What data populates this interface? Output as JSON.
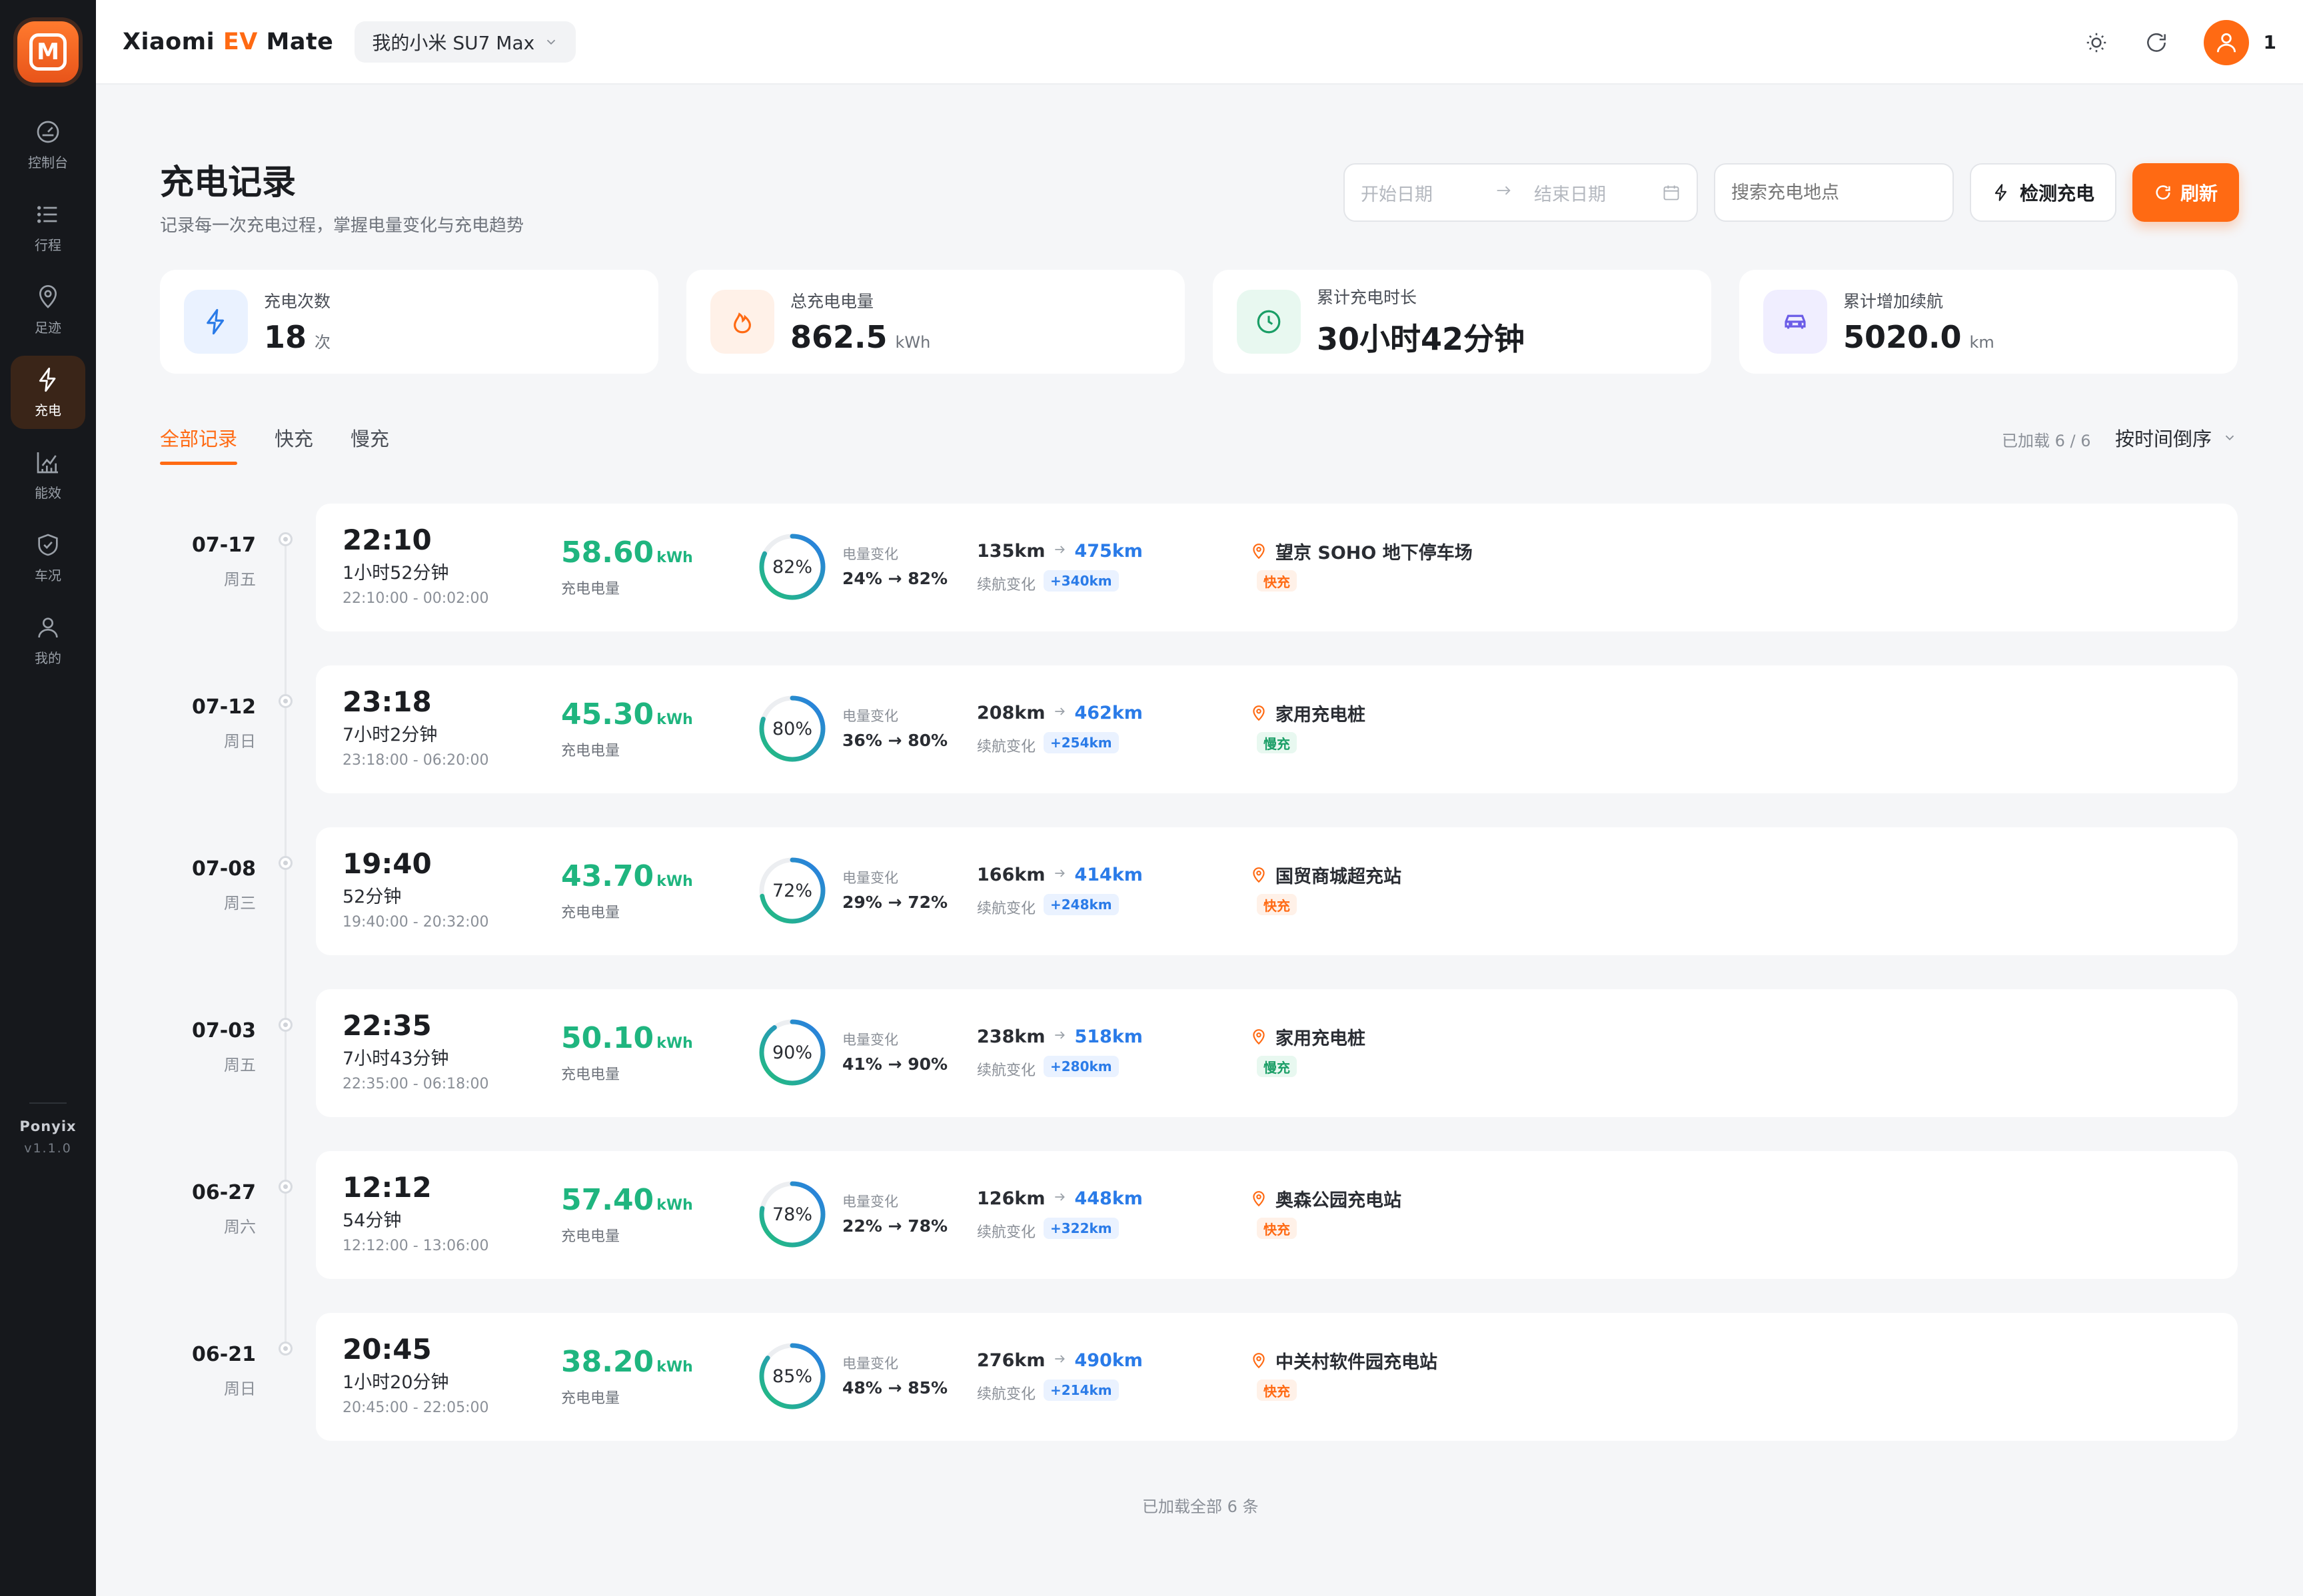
{
  "app": {
    "logo_letter": "M",
    "brand_prefix": "Xiaomi ",
    "brand_ev": "EV",
    "brand_suffix": " Mate",
    "car": "我的小米 SU7 Max",
    "user_count": "1",
    "accent_color": "#ff6a13"
  },
  "sidebar": {
    "items": [
      {
        "label": "控制台",
        "icon": "gauge-icon"
      },
      {
        "label": "行程",
        "icon": "list-icon"
      },
      {
        "label": "足迹",
        "icon": "map-pin-icon"
      },
      {
        "label": "充电",
        "icon": "lightning-icon"
      },
      {
        "label": "能效",
        "icon": "chart-icon"
      },
      {
        "label": "车况",
        "icon": "shield-check-icon"
      },
      {
        "label": "我的",
        "icon": "user-icon"
      }
    ],
    "active": "充电",
    "footer_name": "Ponyix",
    "footer_version": "v1.1.0"
  },
  "page": {
    "title": "充电记录",
    "subtitle": "记录每一次充电过程，掌握电量变化与充电趋势",
    "start_date_placeholder": "开始日期",
    "end_date_placeholder": "结束日期",
    "search_placeholder": "搜索充电地点",
    "detect_label": "检测充电",
    "refresh_label": "刷新"
  },
  "stats": [
    {
      "label": "充电次数",
      "value": "18",
      "unit": "次"
    },
    {
      "label": "总充电电量",
      "value": "862.5",
      "unit": "kWh"
    },
    {
      "label": "累计充电时长",
      "value": "30小时42分钟",
      "unit": ""
    },
    {
      "label": "累计增加续航",
      "value": "5020.0",
      "unit": "km"
    }
  ],
  "tabs": [
    {
      "label": "全部记录"
    },
    {
      "label": "快充"
    },
    {
      "label": "慢充"
    }
  ],
  "list_meta": {
    "loaded": "已加载 6 / 6",
    "sort": "按时间倒序",
    "footer": "已加载全部 6 条"
  },
  "labels": {
    "kwh_unit": "kWh",
    "kwh_caption": "充电电量",
    "soc_caption": "电量变化",
    "range_caption": "续航变化"
  },
  "records": [
    {
      "date": "07-17",
      "weekday": "周五",
      "time": "22:10",
      "duration": "1小时52分钟",
      "range": "22:10:00 - 00:02:00",
      "kwh": "58.60",
      "soc_pct": 82,
      "soc_label": "82%",
      "soc_change": "24% → 82%",
      "range_from": "135km",
      "range_to": "475km",
      "range_gain": "+340km",
      "location": "望京 SOHO 地下停车场",
      "type": "快充",
      "type_kind": "fast"
    },
    {
      "date": "07-12",
      "weekday": "周日",
      "time": "23:18",
      "duration": "7小时2分钟",
      "range": "23:18:00 - 06:20:00",
      "kwh": "45.30",
      "soc_pct": 80,
      "soc_label": "80%",
      "soc_change": "36% → 80%",
      "range_from": "208km",
      "range_to": "462km",
      "range_gain": "+254km",
      "location": "家用充电桩",
      "type": "慢充",
      "type_kind": "slow"
    },
    {
      "date": "07-08",
      "weekday": "周三",
      "time": "19:40",
      "duration": "52分钟",
      "range": "19:40:00 - 20:32:00",
      "kwh": "43.70",
      "soc_pct": 72,
      "soc_label": "72%",
      "soc_change": "29% → 72%",
      "range_from": "166km",
      "range_to": "414km",
      "range_gain": "+248km",
      "location": "国贸商城超充站",
      "type": "快充",
      "type_kind": "fast"
    },
    {
      "date": "07-03",
      "weekday": "周五",
      "time": "22:35",
      "duration": "7小时43分钟",
      "range": "22:35:00 - 06:18:00",
      "kwh": "50.10",
      "soc_pct": 90,
      "soc_label": "90%",
      "soc_change": "41% → 90%",
      "range_from": "238km",
      "range_to": "518km",
      "range_gain": "+280km",
      "location": "家用充电桩",
      "type": "慢充",
      "type_kind": "slow"
    },
    {
      "date": "06-27",
      "weekday": "周六",
      "time": "12:12",
      "duration": "54分钟",
      "range": "12:12:00 - 13:06:00",
      "kwh": "57.40",
      "soc_pct": 78,
      "soc_label": "78%",
      "soc_change": "22% → 78%",
      "range_from": "126km",
      "range_to": "448km",
      "range_gain": "+322km",
      "location": "奥森公园充电站",
      "type": "快充",
      "type_kind": "fast"
    },
    {
      "date": "06-21",
      "weekday": "周日",
      "time": "20:45",
      "duration": "1小时20分钟",
      "range": "20:45:00 - 22:05:00",
      "kwh": "38.20",
      "soc_pct": 85,
      "soc_label": "85%",
      "soc_change": "48% → 85%",
      "range_from": "276km",
      "range_to": "490km",
      "range_gain": "+214km",
      "location": "中关村软件园充电站",
      "type": "快充",
      "type_kind": "fast"
    }
  ]
}
